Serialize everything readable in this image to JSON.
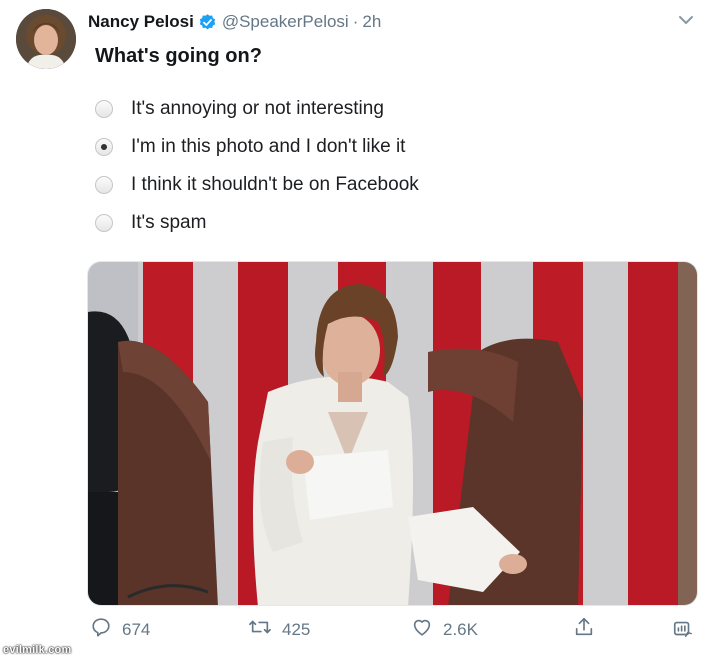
{
  "tweet": {
    "author_name": "Nancy Pelosi",
    "handle": "@SpeakerPelosi",
    "separator": "·",
    "time": "2h",
    "question": "What's going on?"
  },
  "options": [
    {
      "label": "It's annoying or not interesting",
      "checked": false
    },
    {
      "label": "I'm in this photo and I don't like it",
      "checked": true
    },
    {
      "label": "I think it shouldn't be on Facebook",
      "checked": false
    },
    {
      "label": "It's spam",
      "checked": false
    }
  ],
  "actions": {
    "replies": "674",
    "retweets": "425",
    "likes": "2.6K"
  },
  "watermark": "evilmilk.com",
  "icons": {
    "verified": "verified-badge-icon",
    "caret": "chevron-down-icon",
    "reply": "reply-icon",
    "retweet": "retweet-icon",
    "like": "heart-icon",
    "share": "share-icon",
    "analytics": "analytics-icon"
  },
  "colors": {
    "verified_blue": "#1da1f2",
    "secondary_text": "#657786",
    "primary_text": "#14171a"
  }
}
